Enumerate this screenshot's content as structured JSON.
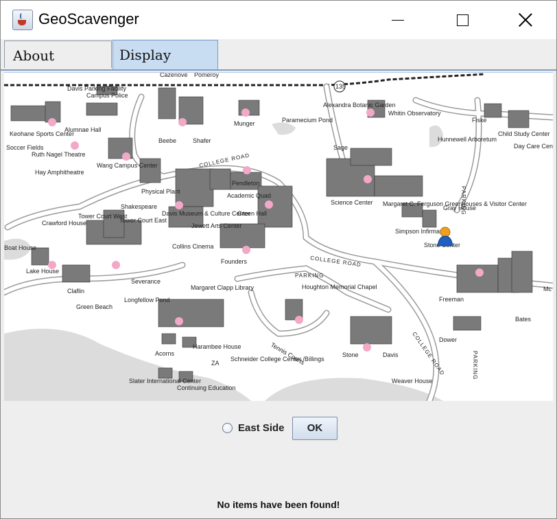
{
  "window": {
    "title": "GeoScavenger",
    "app_icon": "java-cup-icon",
    "controls": [
      "minimize-icon",
      "maximize-icon",
      "close-icon"
    ]
  },
  "tabs": [
    {
      "label": "About",
      "selected": false
    },
    {
      "label": "Display",
      "selected": true
    }
  ],
  "map": {
    "description_icon": "campus-map",
    "route_number": "135",
    "labels": {
      "davis_parking": "Davis Parking Facility",
      "campus_police": "Campus Police",
      "cazenove": "Cazenove",
      "pomeroy": "Pomeroy",
      "beebe": "Beebe",
      "shafer": "Shafer",
      "munger": "Munger",
      "paramecium_pond": "Paramecium Pond",
      "alexandra_garden": "Alexandra Botanic Garden",
      "whitin": "Whitin Observatory",
      "fiske": "Fiske",
      "child_study": "Child Study Center",
      "hunnewell": "Hunnewell Arboretum",
      "day_care": "Day Care Center",
      "keohane": "Keohane Sports Center",
      "alumnae_hall": "Alumnae Hall",
      "soccer": "Soccer Fields",
      "ruth_nagel": "Ruth Nagel Theatre",
      "hay": "Hay Amphitheatre",
      "wang": "Wang Campus Center",
      "college_road": "COLLEGE ROAD",
      "pendleton": "Pendleton",
      "academic_quad": "Academic Quad",
      "green_hall": "Green Hall",
      "physical_plant": "Physical Plant",
      "shakespeare": "Shakespeare",
      "tower_west": "Tower Court West",
      "tower_east": "Tower Court East",
      "davis_museum": "Davis Museum & Culture Center",
      "jewett": "Jewett Arts Center",
      "collins": "Collins Cinema",
      "founders": "Founders",
      "crawford": "Crawford House",
      "sage": "Sage",
      "science_center": "Science Center",
      "ferguson": "Margaret C. Ferguson Greenhouses & Visitor Center",
      "simpson": "Simpson Infirmary",
      "stone_center": "Stone Center",
      "gray_house": "Gray House",
      "parking": "PARKING",
      "lake_house": "Lake House",
      "claflin": "Claflin",
      "severance": "Severance",
      "green_beach": "Green Beach",
      "longfellow": "Longfellow Pond",
      "clapp": "Margaret Clapp Library",
      "houghton": "Houghton Memorial Chapel",
      "freeman": "Freeman",
      "bates": "Bates",
      "acorns": "Acorns",
      "harambee": "Harambee House",
      "za": "ZA",
      "schneider": "Schneider College Center /Billings",
      "tennis": "Tennis Courts",
      "stone": "Stone",
      "davis": "Davis",
      "dower": "Dower",
      "slater": "Slater International Center",
      "continuing": "Continuing Education",
      "weaver": "Weaver House",
      "boat_house": "Boat House",
      "mc": "Mc"
    },
    "user_marker_icon": "user-location-icon",
    "item_marker_icon": "pink-dot-icon"
  },
  "controls": {
    "radio_label": "East Side",
    "radio_checked": false,
    "ok_label": "OK"
  },
  "status": "No items have been found!"
}
